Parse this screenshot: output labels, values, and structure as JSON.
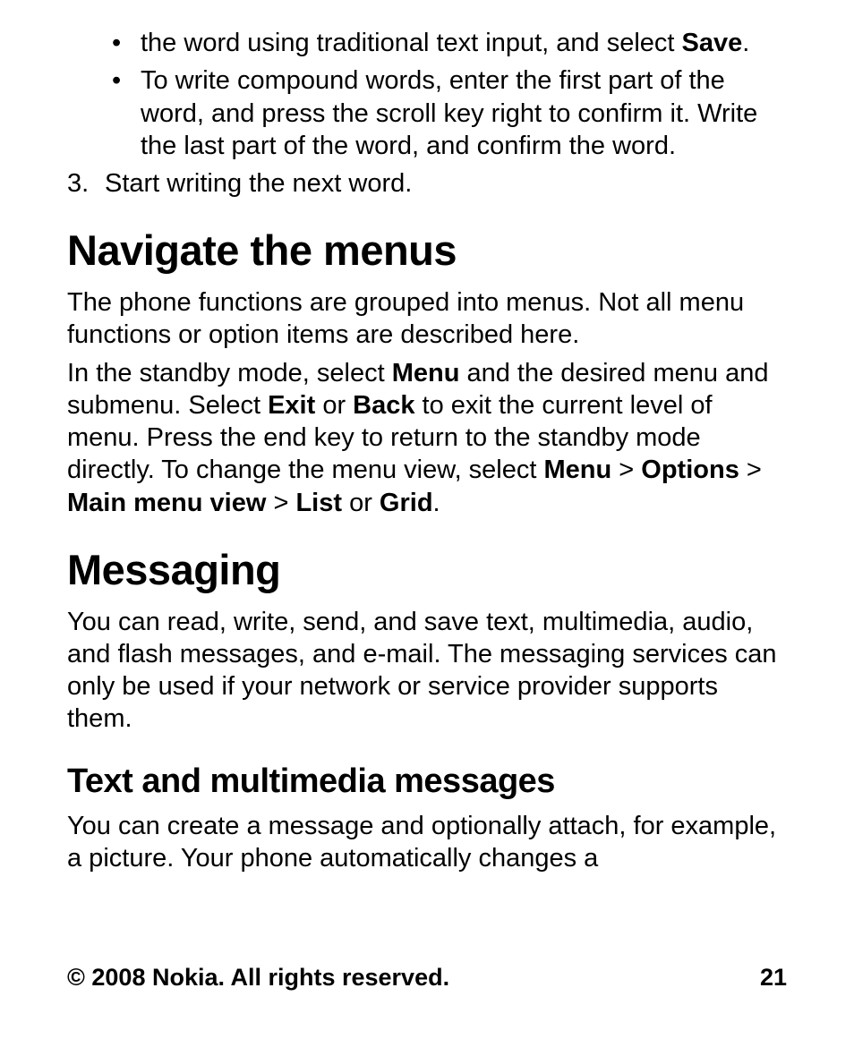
{
  "bullet1_pre": "the word using traditional text input, and select ",
  "bullet1_bold": "Save",
  "bullet1_post": ".",
  "bullet2": "To write compound words, enter the first part of the word, and press the scroll key right to confirm it. Write the last part of the word, and confirm the word.",
  "step3_num": "3.",
  "step3_text": "Start writing the next word.",
  "h1_navigate": "Navigate the menus",
  "navigate_p1": "The phone functions are grouped into menus. Not all menu functions or option items are described here.",
  "nav_a": "In the standby mode, select ",
  "nav_b": "Menu",
  "nav_c": " and the desired menu and submenu. Select ",
  "nav_d": "Exit",
  "nav_e": " or ",
  "nav_f": "Back",
  "nav_g": " to exit the current level of menu. Press the end key to return to the standby mode directly. To change the menu view, select ",
  "nav_h": "Menu",
  "nav_i": " > ",
  "nav_j": "Options",
  "nav_k": " > ",
  "nav_l": "Main menu view",
  "nav_m": " > ",
  "nav_n": "List",
  "nav_o": " or ",
  "nav_p": "Grid",
  "nav_q": ".",
  "h1_messaging": "Messaging",
  "messaging_p1": "You can read, write, send, and save text, multimedia, audio, and flash messages, and e-mail. The messaging services can only be used if your network or service provider supports them.",
  "h2_text": "Text and multimedia messages",
  "text_p1": "You can create a message and optionally attach, for example, a picture. Your phone automatically changes a",
  "footer_left": "© 2008 Nokia. All rights reserved.",
  "footer_right": "21"
}
